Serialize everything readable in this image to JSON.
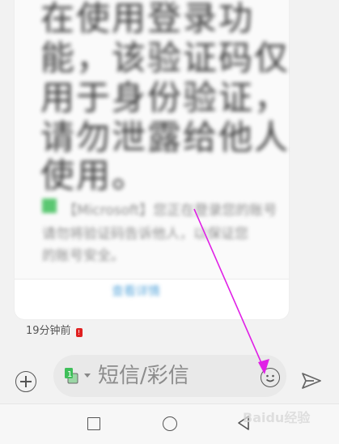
{
  "message": {
    "body_lines": [
      "在使用登录功",
      "能，该验证码仅",
      "用于身份验证，",
      "请勿泄露给他人",
      "使用。"
    ],
    "body_small_lines": [
      "【Microsoft】您正在登录您的账号",
      "请勿将验证码告诉他人，以保证您",
      "的账号安全。"
    ],
    "card_link": "查看详情",
    "time": "19分钟前"
  },
  "composer": {
    "placeholder": "短信/彩信",
    "sim_label": "1"
  },
  "watermark": "Baidu经验",
  "colors": {
    "arrow": "#e020e6",
    "fail_badge": "#e02020",
    "sim_green": "#3fbf5a"
  },
  "icons": {
    "add": "add-circle-icon",
    "emoji": "emoji-smile-icon",
    "send": "send-arrow-icon",
    "nav_recent": "square-icon",
    "nav_home": "circle-icon",
    "nav_back": "triangle-back-icon"
  }
}
